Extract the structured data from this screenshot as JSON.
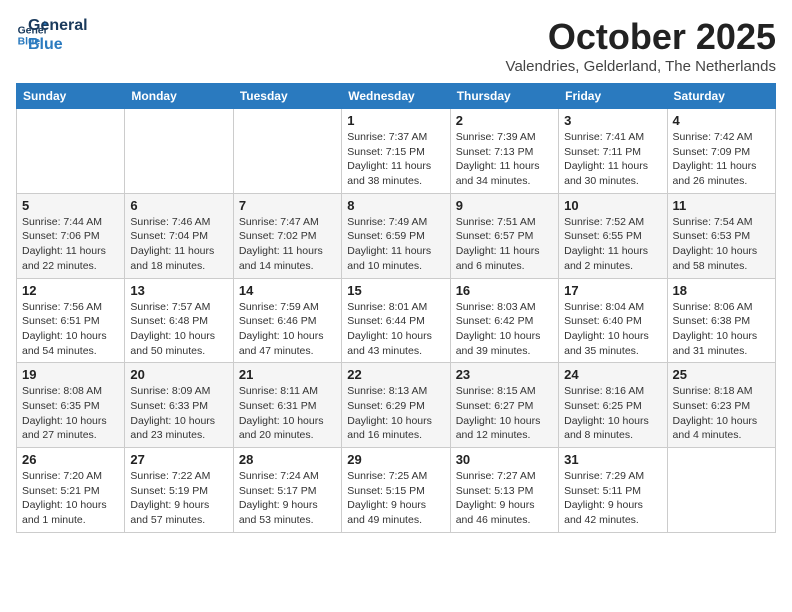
{
  "logo": {
    "line1": "General",
    "line2": "Blue"
  },
  "title": "October 2025",
  "subtitle": "Valendries, Gelderland, The Netherlands",
  "days_of_week": [
    "Sunday",
    "Monday",
    "Tuesday",
    "Wednesday",
    "Thursday",
    "Friday",
    "Saturday"
  ],
  "weeks": [
    [
      {
        "day": "",
        "sunrise": "",
        "sunset": "",
        "daylight": ""
      },
      {
        "day": "",
        "sunrise": "",
        "sunset": "",
        "daylight": ""
      },
      {
        "day": "",
        "sunrise": "",
        "sunset": "",
        "daylight": ""
      },
      {
        "day": "1",
        "sunrise": "Sunrise: 7:37 AM",
        "sunset": "Sunset: 7:15 PM",
        "daylight": "Daylight: 11 hours and 38 minutes."
      },
      {
        "day": "2",
        "sunrise": "Sunrise: 7:39 AM",
        "sunset": "Sunset: 7:13 PM",
        "daylight": "Daylight: 11 hours and 34 minutes."
      },
      {
        "day": "3",
        "sunrise": "Sunrise: 7:41 AM",
        "sunset": "Sunset: 7:11 PM",
        "daylight": "Daylight: 11 hours and 30 minutes."
      },
      {
        "day": "4",
        "sunrise": "Sunrise: 7:42 AM",
        "sunset": "Sunset: 7:09 PM",
        "daylight": "Daylight: 11 hours and 26 minutes."
      }
    ],
    [
      {
        "day": "5",
        "sunrise": "Sunrise: 7:44 AM",
        "sunset": "Sunset: 7:06 PM",
        "daylight": "Daylight: 11 hours and 22 minutes."
      },
      {
        "day": "6",
        "sunrise": "Sunrise: 7:46 AM",
        "sunset": "Sunset: 7:04 PM",
        "daylight": "Daylight: 11 hours and 18 minutes."
      },
      {
        "day": "7",
        "sunrise": "Sunrise: 7:47 AM",
        "sunset": "Sunset: 7:02 PM",
        "daylight": "Daylight: 11 hours and 14 minutes."
      },
      {
        "day": "8",
        "sunrise": "Sunrise: 7:49 AM",
        "sunset": "Sunset: 6:59 PM",
        "daylight": "Daylight: 11 hours and 10 minutes."
      },
      {
        "day": "9",
        "sunrise": "Sunrise: 7:51 AM",
        "sunset": "Sunset: 6:57 PM",
        "daylight": "Daylight: 11 hours and 6 minutes."
      },
      {
        "day": "10",
        "sunrise": "Sunrise: 7:52 AM",
        "sunset": "Sunset: 6:55 PM",
        "daylight": "Daylight: 11 hours and 2 minutes."
      },
      {
        "day": "11",
        "sunrise": "Sunrise: 7:54 AM",
        "sunset": "Sunset: 6:53 PM",
        "daylight": "Daylight: 10 hours and 58 minutes."
      }
    ],
    [
      {
        "day": "12",
        "sunrise": "Sunrise: 7:56 AM",
        "sunset": "Sunset: 6:51 PM",
        "daylight": "Daylight: 10 hours and 54 minutes."
      },
      {
        "day": "13",
        "sunrise": "Sunrise: 7:57 AM",
        "sunset": "Sunset: 6:48 PM",
        "daylight": "Daylight: 10 hours and 50 minutes."
      },
      {
        "day": "14",
        "sunrise": "Sunrise: 7:59 AM",
        "sunset": "Sunset: 6:46 PM",
        "daylight": "Daylight: 10 hours and 47 minutes."
      },
      {
        "day": "15",
        "sunrise": "Sunrise: 8:01 AM",
        "sunset": "Sunset: 6:44 PM",
        "daylight": "Daylight: 10 hours and 43 minutes."
      },
      {
        "day": "16",
        "sunrise": "Sunrise: 8:03 AM",
        "sunset": "Sunset: 6:42 PM",
        "daylight": "Daylight: 10 hours and 39 minutes."
      },
      {
        "day": "17",
        "sunrise": "Sunrise: 8:04 AM",
        "sunset": "Sunset: 6:40 PM",
        "daylight": "Daylight: 10 hours and 35 minutes."
      },
      {
        "day": "18",
        "sunrise": "Sunrise: 8:06 AM",
        "sunset": "Sunset: 6:38 PM",
        "daylight": "Daylight: 10 hours and 31 minutes."
      }
    ],
    [
      {
        "day": "19",
        "sunrise": "Sunrise: 8:08 AM",
        "sunset": "Sunset: 6:35 PM",
        "daylight": "Daylight: 10 hours and 27 minutes."
      },
      {
        "day": "20",
        "sunrise": "Sunrise: 8:09 AM",
        "sunset": "Sunset: 6:33 PM",
        "daylight": "Daylight: 10 hours and 23 minutes."
      },
      {
        "day": "21",
        "sunrise": "Sunrise: 8:11 AM",
        "sunset": "Sunset: 6:31 PM",
        "daylight": "Daylight: 10 hours and 20 minutes."
      },
      {
        "day": "22",
        "sunrise": "Sunrise: 8:13 AM",
        "sunset": "Sunset: 6:29 PM",
        "daylight": "Daylight: 10 hours and 16 minutes."
      },
      {
        "day": "23",
        "sunrise": "Sunrise: 8:15 AM",
        "sunset": "Sunset: 6:27 PM",
        "daylight": "Daylight: 10 hours and 12 minutes."
      },
      {
        "day": "24",
        "sunrise": "Sunrise: 8:16 AM",
        "sunset": "Sunset: 6:25 PM",
        "daylight": "Daylight: 10 hours and 8 minutes."
      },
      {
        "day": "25",
        "sunrise": "Sunrise: 8:18 AM",
        "sunset": "Sunset: 6:23 PM",
        "daylight": "Daylight: 10 hours and 4 minutes."
      }
    ],
    [
      {
        "day": "26",
        "sunrise": "Sunrise: 7:20 AM",
        "sunset": "Sunset: 5:21 PM",
        "daylight": "Daylight: 10 hours and 1 minute."
      },
      {
        "day": "27",
        "sunrise": "Sunrise: 7:22 AM",
        "sunset": "Sunset: 5:19 PM",
        "daylight": "Daylight: 9 hours and 57 minutes."
      },
      {
        "day": "28",
        "sunrise": "Sunrise: 7:24 AM",
        "sunset": "Sunset: 5:17 PM",
        "daylight": "Daylight: 9 hours and 53 minutes."
      },
      {
        "day": "29",
        "sunrise": "Sunrise: 7:25 AM",
        "sunset": "Sunset: 5:15 PM",
        "daylight": "Daylight: 9 hours and 49 minutes."
      },
      {
        "day": "30",
        "sunrise": "Sunrise: 7:27 AM",
        "sunset": "Sunset: 5:13 PM",
        "daylight": "Daylight: 9 hours and 46 minutes."
      },
      {
        "day": "31",
        "sunrise": "Sunrise: 7:29 AM",
        "sunset": "Sunset: 5:11 PM",
        "daylight": "Daylight: 9 hours and 42 minutes."
      },
      {
        "day": "",
        "sunrise": "",
        "sunset": "",
        "daylight": ""
      }
    ]
  ]
}
